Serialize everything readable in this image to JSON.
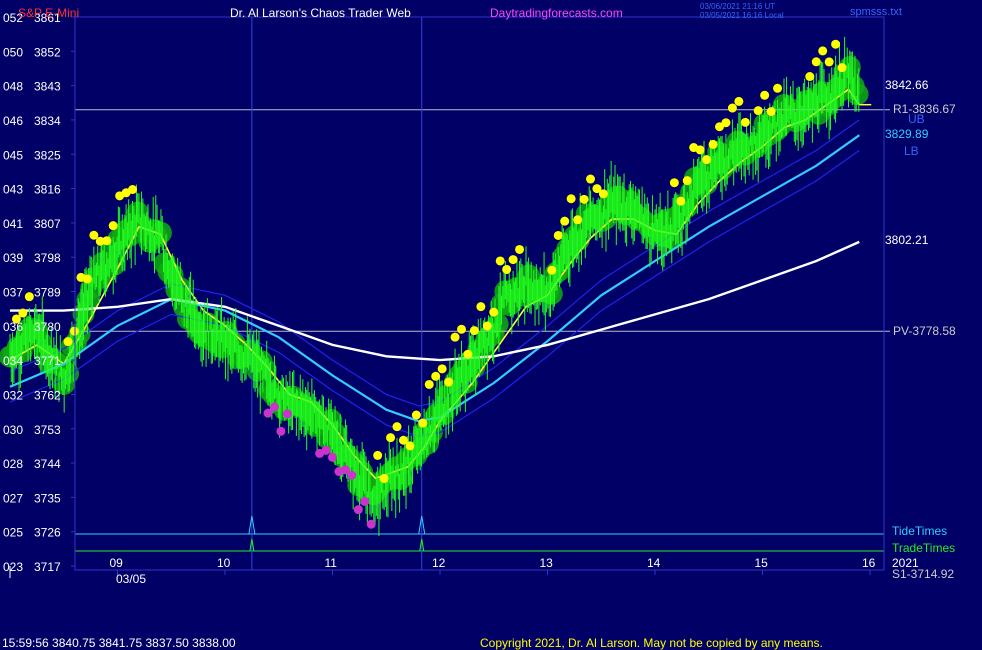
{
  "header": {
    "symbol": "S&P E-Mini",
    "title": "Dr. Al Larson's Chaos Trader Web",
    "site": "Daytradingforecasts.com",
    "time_utc": "03/06/2021 21:16 UT",
    "time_local": "03/05/2021 16:16 Local",
    "file": "spmsss.txt"
  },
  "footer": {
    "quote": "15:59:56  3840.75 3841.75 3837.50 3838.00",
    "copyright": "Copyright 2021, Dr. Al Larson. May not be copied by any means."
  },
  "colors": {
    "background": "#000066",
    "frame": "#3333cc",
    "price_bars": "#22ff22",
    "high_glow": "#11aa11",
    "high_dots": "#ffff00",
    "low_dots": "#cc33cc",
    "fast_ma": "#ffff33",
    "mid_ma": "#33ccff",
    "slow_ma": "#ffffff",
    "band": "#2222ee",
    "tide": "#33ccff",
    "trade": "#22ee22"
  },
  "chart_data": {
    "type": "line",
    "x_axis": {
      "ticks": [
        "09",
        "10",
        "11",
        "12",
        "13",
        "14",
        "15",
        "16"
      ],
      "date_label": "03/05"
    },
    "y_axis": {
      "ylim": [
        3717,
        3861
      ],
      "ticks": [
        3861,
        3852,
        3843,
        3834,
        3825,
        3816,
        3807,
        3798,
        3789,
        3780,
        3771,
        3762,
        3753,
        3744,
        3735,
        3726,
        3717
      ],
      "left_ticks": [
        "052",
        "050",
        "048",
        "046",
        "045",
        "043",
        "041",
        "039",
        "037",
        "036",
        "034",
        "032",
        "030",
        "028",
        "027",
        "025",
        "023"
      ]
    },
    "x_range": [
      8.0,
      16.0
    ],
    "price": {
      "x": [
        8.0,
        8.25,
        8.5,
        8.75,
        9.0,
        9.2,
        9.4,
        9.6,
        9.8,
        10.0,
        10.2,
        10.4,
        10.6,
        10.8,
        11.0,
        11.2,
        11.4,
        11.5,
        11.7,
        11.85,
        12.0,
        12.3,
        12.6,
        12.8,
        13.0,
        13.2,
        13.4,
        13.6,
        13.8,
        14.0,
        14.2,
        14.4,
        14.6,
        14.8,
        15.0,
        15.2,
        15.4,
        15.6,
        15.8,
        15.9
      ],
      "close": [
        3772,
        3779,
        3766,
        3790,
        3800,
        3808,
        3802,
        3787,
        3779,
        3776,
        3772,
        3766,
        3759,
        3758,
        3752,
        3742,
        3734,
        3738,
        3743,
        3750,
        3758,
        3770,
        3786,
        3791,
        3788,
        3801,
        3808,
        3812,
        3811,
        3804,
        3806,
        3818,
        3823,
        3827,
        3830,
        3835,
        3836,
        3840,
        3846,
        3838
      ]
    },
    "series": [
      {
        "x": [
          8.0,
          8.25,
          8.5,
          8.75,
          9.0,
          9.2,
          9.4,
          9.6,
          9.8,
          10.0,
          10.2,
          10.4,
          10.6,
          10.8,
          11.0,
          11.2,
          11.4,
          11.5,
          11.7,
          11.85,
          12.0,
          12.3,
          12.6,
          12.8,
          13.0,
          13.2,
          13.4,
          13.6,
          13.8,
          14.0,
          14.2,
          14.4,
          14.6,
          14.8,
          15.0,
          15.2,
          15.4,
          15.6,
          15.8,
          15.9
        ],
        "values": [
          3771,
          3775,
          3770,
          3782,
          3795,
          3806,
          3804,
          3792,
          3784,
          3780,
          3775,
          3769,
          3762,
          3760,
          3754,
          3746,
          3740,
          3741,
          3743,
          3748,
          3755,
          3765,
          3777,
          3785,
          3788,
          3796,
          3803,
          3808,
          3808,
          3805,
          3804,
          3812,
          3818,
          3823,
          3827,
          3832,
          3834,
          3838,
          3842,
          3838
        ]
      },
      {
        "x": [
          8.0,
          8.5,
          9.0,
          9.5,
          10.0,
          10.5,
          11.0,
          11.5,
          11.8,
          12.0,
          12.5,
          13.0,
          13.5,
          14.0,
          14.5,
          15.0,
          15.5,
          15.9
        ],
        "values": [
          3764,
          3770,
          3780,
          3787,
          3784,
          3777,
          3767,
          3758,
          3755,
          3756,
          3765,
          3776,
          3788,
          3797,
          3806,
          3814,
          3822,
          3830
        ]
      },
      {
        "x": [
          8.0,
          8.5,
          9.0,
          9.5,
          10.0,
          10.5,
          11.0,
          11.5,
          12.0,
          12.5,
          13.0,
          13.5,
          14.0,
          14.5,
          15.0,
          15.5,
          15.9
        ],
        "values": [
          3784,
          3784,
          3785,
          3787,
          3785,
          3780,
          3775,
          3772,
          3771,
          3772,
          3775,
          3779,
          3783,
          3787,
          3792,
          3797,
          3802
        ]
      }
    ],
    "hlines": [
      {
        "label": "R1-3836.67",
        "value": 3836.67
      },
      {
        "label": "PV-3778.58",
        "value": 3778.58
      }
    ],
    "right_labels": {
      "last_price": "3842.66",
      "ub": "UB",
      "mid_value": "3829.89",
      "lb": "LB",
      "slow_value": "3802.21",
      "tide": "TideTimes",
      "trade": "TradeTimes",
      "year": "2021",
      "s1": "S1-3714.92"
    },
    "tide_spikes_x": [
      10.25,
      11.83
    ]
  }
}
